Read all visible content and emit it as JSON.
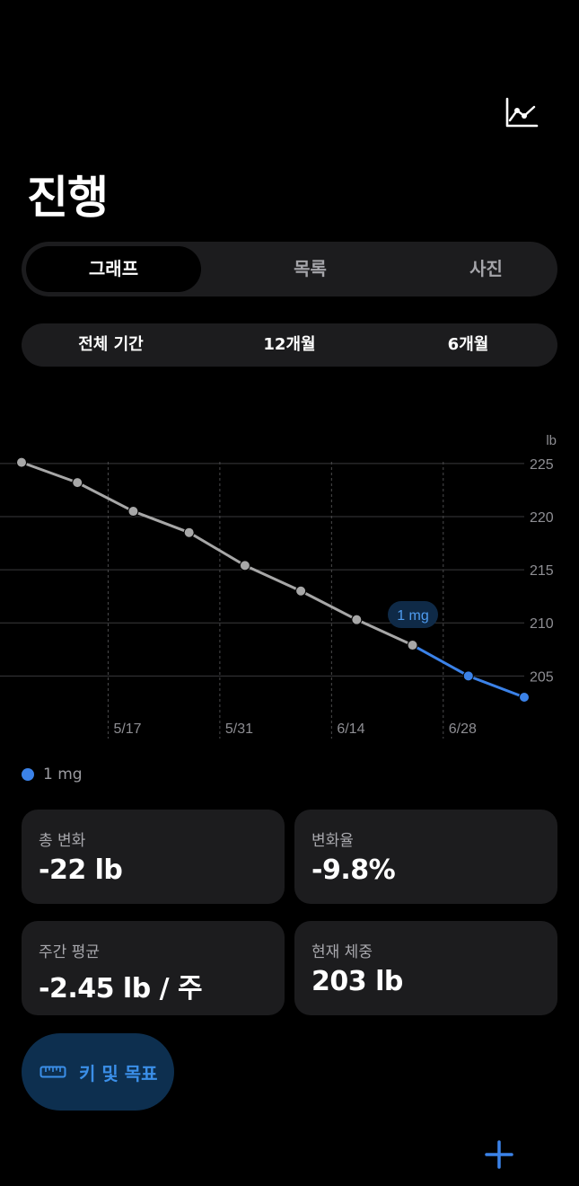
{
  "header": {
    "chart_icon": "line-chart-icon",
    "title": "진행"
  },
  "view_tabs": [
    {
      "label": "그래프",
      "active": true
    },
    {
      "label": "목록",
      "active": false
    },
    {
      "label": "사진",
      "active": false
    }
  ],
  "range_tabs": [
    {
      "label": "전체 기간"
    },
    {
      "label": "12개월"
    },
    {
      "label": "6개월"
    }
  ],
  "chart_data": {
    "type": "line",
    "unit_label": "lb",
    "ylim": [
      203,
      226
    ],
    "y_ticks": [
      225,
      220,
      215,
      210,
      205
    ],
    "x_tick_labels": [
      "5/17",
      "5/31",
      "6/14",
      "6/28"
    ],
    "grid": true,
    "series": [
      {
        "name": "1 mg",
        "color": "#3b82e8",
        "values": [
          225.1,
          223.2,
          220.5,
          218.5,
          215.4,
          213.0,
          210.3,
          207.9,
          205.0,
          203.0
        ],
        "highlight_from_index": 7
      }
    ],
    "base_color": "#a7a7a7",
    "annotation": {
      "label": "1 mg"
    }
  },
  "legend": {
    "label": "1 mg",
    "color": "#3b82e8"
  },
  "stats": [
    {
      "label": "총 변화",
      "value": "-22 lb"
    },
    {
      "label": "변화율",
      "value": "-9.8%"
    },
    {
      "label": "주간 평균",
      "value": "-2.45 lb / 주"
    },
    {
      "label": "현재 체중",
      "value": "203 lb"
    }
  ],
  "goals_button": {
    "label": "키 및 목표",
    "icon": "ruler-icon"
  },
  "add_button": {
    "icon": "plus-icon"
  },
  "colors": {
    "accent": "#3b82e8",
    "card_bg": "#1c1c1e",
    "background": "#000000"
  }
}
